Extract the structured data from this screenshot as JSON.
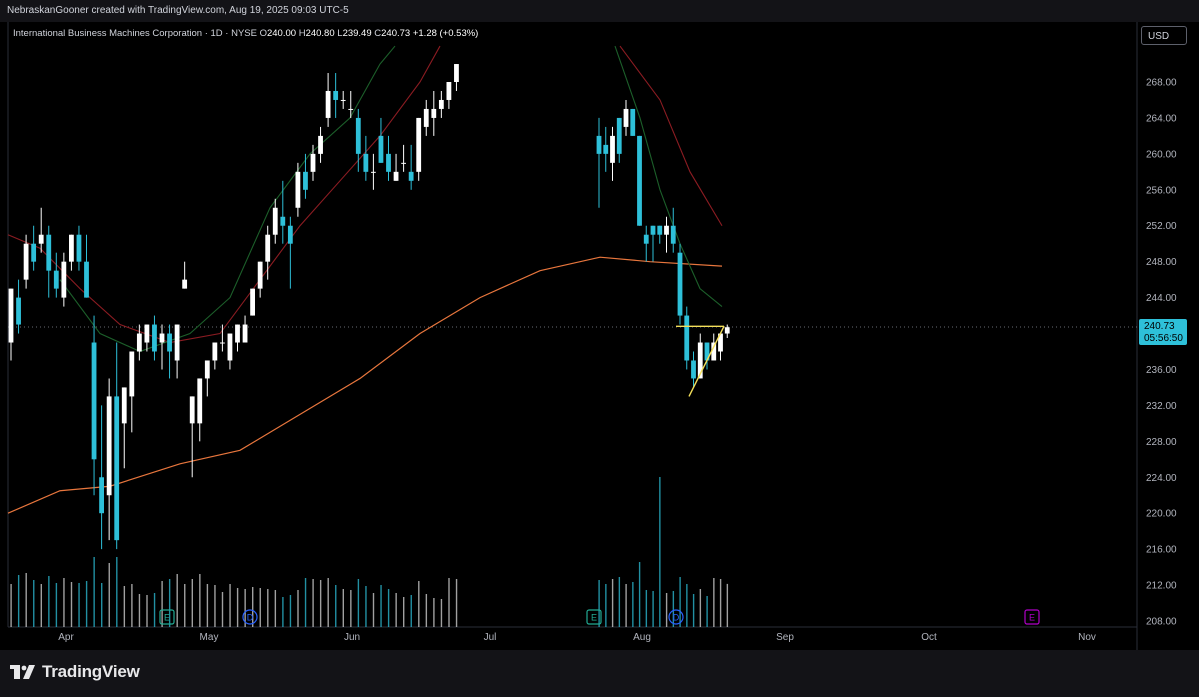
{
  "header": {
    "attribution": "NebraskanGooner created with TradingView.com, Aug 19, 2025 09:03 UTC-5"
  },
  "legend": {
    "symbol": "International Business Machines Corporation · 1D · NYSE",
    "o_label": "O",
    "o_value": "240.00",
    "h_label": "H",
    "h_value": "240.80",
    "l_label": "L",
    "l_value": "239.49",
    "c_label": "C",
    "c_value": "240.73",
    "change": "+1.28 (+0.53%)"
  },
  "currency_button": "USD",
  "price_tag": {
    "price": "240.73",
    "countdown": "05:56:50"
  },
  "footer": {
    "brand": "TradingView"
  },
  "colors": {
    "background": "#000000",
    "up_candle": "#ffffff",
    "down_candle": "#2ec0d9",
    "ma_orange": "#e8763d",
    "ma_red": "#8c1c22",
    "ma_green": "#1c5f2a",
    "pattern": "#f4e05a",
    "earnings_marker": "#b000c8",
    "dividend_marker": "#2962ff",
    "event_e": "#22ab94"
  },
  "chart_data": {
    "type": "candlestick",
    "ylim": [
      206,
      272
    ],
    "y_ticks": [
      "208.00",
      "212.00",
      "216.00",
      "220.00",
      "224.00",
      "228.00",
      "232.00",
      "236.00",
      "240.00",
      "244.00",
      "248.00",
      "252.00",
      "256.00",
      "260.00",
      "264.00",
      "268.00"
    ],
    "x_ticks": [
      "Apr",
      "May",
      "Jun",
      "Jul",
      "Aug",
      "Sep",
      "Oct",
      "Nov"
    ],
    "last_price": 240.73,
    "candles": [
      {
        "o": 239,
        "h": 245,
        "l": 237,
        "c": 245
      },
      {
        "o": 244,
        "h": 246,
        "l": 240,
        "c": 241
      },
      {
        "o": 246,
        "h": 251,
        "l": 245,
        "c": 250
      },
      {
        "o": 250,
        "h": 252,
        "l": 247,
        "c": 248
      },
      {
        "o": 250,
        "h": 254,
        "l": 249,
        "c": 251
      },
      {
        "o": 251,
        "h": 252,
        "l": 244,
        "c": 247
      },
      {
        "o": 247,
        "h": 249,
        "l": 244,
        "c": 245
      },
      {
        "o": 244,
        "h": 249,
        "l": 243,
        "c": 248
      },
      {
        "o": 248,
        "h": 251,
        "l": 247,
        "c": 251
      },
      {
        "o": 251,
        "h": 252,
        "l": 247,
        "c": 248
      },
      {
        "o": 248,
        "h": 251,
        "l": 244,
        "c": 244
      },
      {
        "o": 239,
        "h": 242,
        "l": 222,
        "c": 226
      },
      {
        "o": 224,
        "h": 232,
        "l": 216,
        "c": 220
      },
      {
        "o": 222,
        "h": 235,
        "l": 217,
        "c": 233
      },
      {
        "o": 233,
        "h": 239,
        "l": 216,
        "c": 217
      },
      {
        "o": 230,
        "h": 234,
        "l": 225,
        "c": 234
      },
      {
        "o": 233,
        "h": 238,
        "l": 229,
        "c": 238
      },
      {
        "o": 238,
        "h": 241,
        "l": 237,
        "c": 240
      },
      {
        "o": 239,
        "h": 241,
        "l": 238,
        "c": 241
      },
      {
        "o": 241,
        "h": 242,
        "l": 237,
        "c": 238
      },
      {
        "o": 239,
        "h": 241,
        "l": 236,
        "c": 240
      },
      {
        "o": 240,
        "h": 241,
        "l": 235,
        "c": 238
      },
      {
        "o": 237,
        "h": 241,
        "l": 235,
        "c": 241
      },
      {
        "o": 245,
        "h": 248,
        "l": 245,
        "c": 246
      },
      {
        "o": 230,
        "h": 233,
        "l": 224,
        "c": 233
      },
      {
        "o": 230,
        "h": 232,
        "l": 228,
        "c": 235
      },
      {
        "o": 235,
        "h": 237,
        "l": 233,
        "c": 237
      },
      {
        "o": 237,
        "h": 239,
        "l": 236,
        "c": 239
      },
      {
        "o": 239,
        "h": 241,
        "l": 238,
        "c": 239
      },
      {
        "o": 237,
        "h": 240,
        "l": 236,
        "c": 240
      },
      {
        "o": 239,
        "h": 241,
        "l": 238,
        "c": 241
      },
      {
        "o": 239,
        "h": 242,
        "l": 239,
        "c": 241
      },
      {
        "o": 242,
        "h": 245,
        "l": 242,
        "c": 245
      },
      {
        "o": 245,
        "h": 248,
        "l": 244,
        "c": 248
      },
      {
        "o": 248,
        "h": 252,
        "l": 246,
        "c": 251
      },
      {
        "o": 251,
        "h": 255,
        "l": 250,
        "c": 254
      },
      {
        "o": 253,
        "h": 257,
        "l": 250,
        "c": 252
      },
      {
        "o": 252,
        "h": 253,
        "l": 245,
        "c": 250
      },
      {
        "o": 254,
        "h": 259,
        "l": 253,
        "c": 258
      },
      {
        "o": 258,
        "h": 260,
        "l": 255,
        "c": 256
      },
      {
        "o": 258,
        "h": 261,
        "l": 257,
        "c": 260
      },
      {
        "o": 260,
        "h": 263,
        "l": 259,
        "c": 262
      },
      {
        "o": 264,
        "h": 269,
        "l": 263,
        "c": 267
      },
      {
        "o": 267,
        "h": 269,
        "l": 264,
        "c": 266
      },
      {
        "o": 266,
        "h": 267,
        "l": 265,
        "c": 266
      },
      {
        "o": 265,
        "h": 267,
        "l": 264,
        "c": 265
      },
      {
        "o": 264,
        "h": 265,
        "l": 258,
        "c": 260
      },
      {
        "o": 260,
        "h": 262,
        "l": 257,
        "c": 258
      },
      {
        "o": 258,
        "h": 260,
        "l": 256,
        "c": 258
      },
      {
        "o": 262,
        "h": 264,
        "l": 259,
        "c": 259
      },
      {
        "o": 260,
        "h": 262,
        "l": 257,
        "c": 258
      },
      {
        "o": 257,
        "h": 260,
        "l": 257,
        "c": 258
      },
      {
        "o": 259,
        "h": 261,
        "l": 258,
        "c": 259
      },
      {
        "o": 258,
        "h": 261,
        "l": 256,
        "c": 257
      },
      {
        "o": 258,
        "h": 264,
        "l": 257,
        "c": 264
      },
      {
        "o": 263,
        "h": 266,
        "l": 262,
        "c": 265
      },
      {
        "o": 264,
        "h": 267,
        "l": 262,
        "c": 265
      },
      {
        "o": 265,
        "h": 267,
        "l": 264,
        "c": 266
      },
      {
        "o": 266,
        "h": 268,
        "l": 265,
        "c": 268
      },
      {
        "o": 268,
        "h": 270,
        "l": 267,
        "c": 270
      },
      {
        "o": 262,
        "h": 264,
        "l": 254,
        "c": 260
      },
      {
        "o": 261,
        "h": 263,
        "l": 258,
        "c": 260
      },
      {
        "o": 259,
        "h": 263,
        "l": 257,
        "c": 262
      },
      {
        "o": 264,
        "h": 264,
        "l": 259,
        "c": 260
      },
      {
        "o": 263,
        "h": 266,
        "l": 262,
        "c": 265
      },
      {
        "o": 265,
        "h": 265,
        "l": 262,
        "c": 262
      },
      {
        "o": 262,
        "h": 262,
        "l": 252,
        "c": 252
      },
      {
        "o": 251,
        "h": 252,
        "l": 248,
        "c": 250
      },
      {
        "o": 252,
        "h": 252,
        "l": 248,
        "c": 251
      },
      {
        "o": 252,
        "h": 252,
        "l": 250,
        "c": 251
      },
      {
        "o": 251,
        "h": 253,
        "l": 249,
        "c": 252
      },
      {
        "o": 252,
        "h": 254,
        "l": 249,
        "c": 250
      },
      {
        "o": 249,
        "h": 250,
        "l": 241,
        "c": 242
      },
      {
        "o": 242,
        "h": 243,
        "l": 236,
        "c": 237
      },
      {
        "o": 237,
        "h": 238,
        "l": 234,
        "c": 235
      },
      {
        "o": 235,
        "h": 240,
        "l": 235,
        "c": 239
      },
      {
        "o": 239,
        "h": 239,
        "l": 236,
        "c": 237
      },
      {
        "o": 237,
        "h": 240,
        "l": 237,
        "c": 239
      },
      {
        "o": 238,
        "h": 240,
        "l": 237,
        "c": 240
      },
      {
        "o": 240,
        "h": 241,
        "l": 239.5,
        "c": 240.7
      }
    ]
  },
  "events": {
    "e1_label": "E",
    "d1_label": "D",
    "e2_label": "E",
    "d2_label": "D",
    "earnings_label": "E"
  }
}
